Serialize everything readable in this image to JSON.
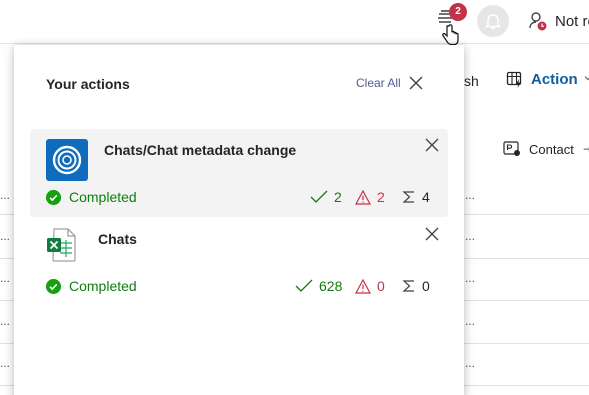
{
  "topbar": {
    "tasks_badge": "2",
    "status_text": "Not re"
  },
  "cmdbar": {
    "partial_label": "sh",
    "action_label": "Action"
  },
  "contact": {
    "label": "Contact"
  },
  "panel": {
    "title": "Your actions",
    "clear_all": "Clear All",
    "cards": [
      {
        "title": "Chats/Chat metadata change",
        "status": "Completed",
        "succeeded": "2",
        "failed": "2",
        "total": "4",
        "icon": "record-icon"
      },
      {
        "title": "Chats",
        "status": "Completed",
        "succeeded": "628",
        "failed": "0",
        "total": "0",
        "icon": "excel-icon"
      }
    ]
  },
  "grid": {
    "ellipsis": "..."
  },
  "colors": {
    "success": "#107c10",
    "error": "#c4314b",
    "accent": "#115ea3",
    "badge": "#c4314b"
  }
}
